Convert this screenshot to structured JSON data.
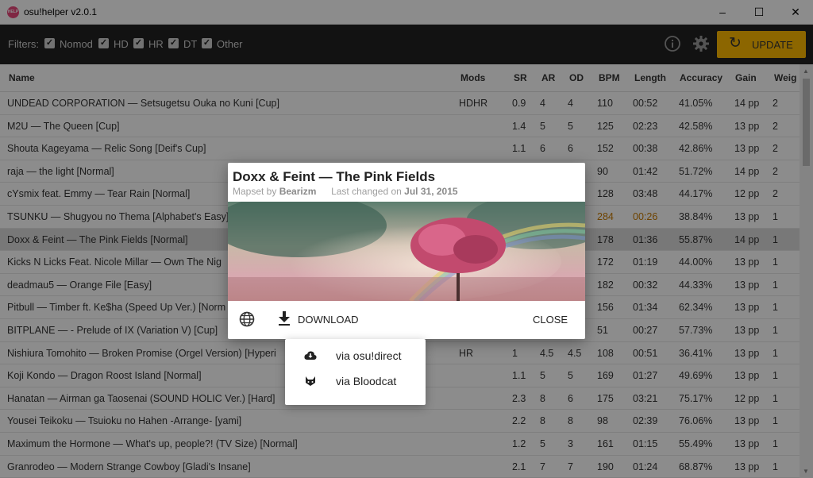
{
  "window": {
    "title": "osu!helper v2.0.1",
    "app_icon_text": "HELP"
  },
  "toolbar": {
    "filters_label": "Filters:",
    "filters": [
      {
        "label": "Nomod",
        "checked": true
      },
      {
        "label": "HD",
        "checked": true
      },
      {
        "label": "HR",
        "checked": true
      },
      {
        "label": "DT",
        "checked": true
      },
      {
        "label": "Other",
        "checked": true
      }
    ],
    "update_label": "UPDATE",
    "accent_color": "#ffbb00"
  },
  "table": {
    "columns": [
      "Name",
      "Mods",
      "SR",
      "AR",
      "OD",
      "BPM",
      "Length",
      "Accuracy",
      "Gain",
      "Weig"
    ],
    "rows": [
      [
        "UNDEAD CORPORATION — Setsugetsu Ouka no Kuni [Cup]",
        "HDHR",
        "0.9",
        "4",
        "4",
        "110",
        "00:52",
        "41.05%",
        "14 pp",
        "2"
      ],
      [
        "M2U — The Queen [Cup]",
        "",
        "1.4",
        "5",
        "5",
        "125",
        "02:23",
        "42.58%",
        "13 pp",
        "2"
      ],
      [
        "Shouta Kageyama — Relic Song [Deif's Cup]",
        "",
        "1.1",
        "6",
        "6",
        "152",
        "00:38",
        "42.86%",
        "13 pp",
        "2"
      ],
      [
        "raja — the light [Normal]",
        "",
        "",
        "",
        "",
        "90",
        "01:42",
        "51.72%",
        "14 pp",
        "2"
      ],
      [
        "cYsmix feat. Emmy — Tear Rain [Normal]",
        "",
        "",
        "",
        "",
        "128",
        "03:48",
        "44.17%",
        "12 pp",
        "2"
      ],
      [
        "TSUNKU — Shugyou no Thema [Alphabet's Easy]",
        "",
        "",
        "",
        "",
        "284",
        "00:26",
        "38.84%",
        "13 pp",
        "1"
      ],
      [
        "Doxx & Feint — The Pink Fields [Normal]",
        "",
        "",
        "",
        "",
        "178",
        "01:36",
        "55.87%",
        "14 pp",
        "1"
      ],
      [
        "Kicks N Licks Feat. Nicole Millar — Own The Nig",
        "",
        "",
        "",
        "",
        "172",
        "01:19",
        "44.00%",
        "13 pp",
        "1"
      ],
      [
        "deadmau5 — Orange File [Easy]",
        "",
        "",
        "",
        "",
        "182",
        "00:32",
        "44.33%",
        "13 pp",
        "1"
      ],
      [
        "Pitbull — Timber ft. Ke$ha (Speed Up Ver.) [Norm",
        "",
        "",
        "",
        "",
        "156",
        "01:34",
        "62.34%",
        "13 pp",
        "1"
      ],
      [
        "BITPLANE — - Prelude of IX (Variation V) [Cup]",
        "",
        "",
        "",
        "",
        "51",
        "00:27",
        "57.73%",
        "13 pp",
        "1"
      ],
      [
        "Nishiura Tomohito — Broken Promise (Orgel Version) [Hyperi",
        "HR",
        "1",
        "4.5",
        "4.5",
        "108",
        "00:51",
        "36.41%",
        "13 pp",
        "1"
      ],
      [
        "Koji Kondo — Dragon Roost Island [Normal]",
        "",
        "1.1",
        "5",
        "5",
        "169",
        "01:27",
        "49.69%",
        "13 pp",
        "1"
      ],
      [
        "Hanatan — Airman ga Taosenai (SOUND HOLIC Ver.) [Hard]",
        "",
        "2.3",
        "8",
        "6",
        "175",
        "03:21",
        "75.17%",
        "12 pp",
        "1"
      ],
      [
        "Yousei Teikoku — Tsuioku no Hahen -Arrange- [yami]",
        "",
        "2.2",
        "8",
        "8",
        "98",
        "02:39",
        "76.06%",
        "13 pp",
        "1"
      ],
      [
        "Maximum the Hormone — What's up, people?! (TV Size) [Normal]",
        "",
        "1.2",
        "5",
        "3",
        "161",
        "01:15",
        "55.49%",
        "13 pp",
        "1"
      ],
      [
        "Granrodeo — Modern Strange Cowboy [Gladi's Insane]",
        "",
        "2.1",
        "7",
        "7",
        "190",
        "01:24",
        "68.87%",
        "13 pp",
        "1"
      ]
    ],
    "selected_row": 6,
    "warn_row": 5,
    "warn_color": "#c87a00"
  },
  "dialog": {
    "title": "Doxx & Feint — The Pink Fields",
    "mapset_by": "Mapset by",
    "mapper": "Bearizm",
    "last_changed": "Last changed on",
    "date": "Jul 31, 2015",
    "download_label": "DOWNLOAD",
    "close_label": "CLOSE"
  },
  "download_menu": {
    "items": [
      {
        "label": "via osu!direct",
        "icon": "cloud-download-icon"
      },
      {
        "label": "via Bloodcat",
        "icon": "cat-icon"
      }
    ]
  }
}
